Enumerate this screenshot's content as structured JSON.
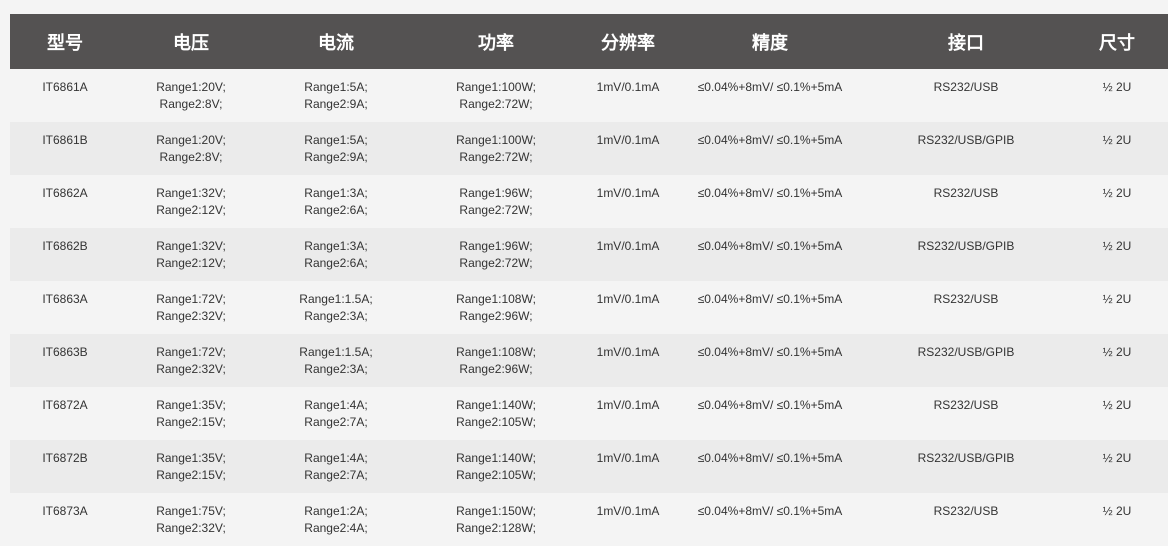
{
  "headers": [
    "型号",
    "电压",
    "电流",
    "功率",
    "分辨率",
    "精度",
    "接口",
    "尺寸"
  ],
  "rows": [
    {
      "model": "IT6861A",
      "voltage": [
        "Range1:20V;",
        "Range2:8V;"
      ],
      "current": [
        "Range1:5A;",
        "Range2:9A;"
      ],
      "power": [
        "Range1:100W;",
        "Range2:72W;"
      ],
      "resolution": "1mV/0.1mA",
      "accuracy": "≤0.04%+8mV/ ≤0.1%+5mA",
      "interface": "RS232/USB",
      "size": "½ 2U"
    },
    {
      "model": "IT6861B",
      "voltage": [
        "Range1:20V;",
        "Range2:8V;"
      ],
      "current": [
        "Range1:5A;",
        "Range2:9A;"
      ],
      "power": [
        "Range1:100W;",
        "Range2:72W;"
      ],
      "resolution": "1mV/0.1mA",
      "accuracy": "≤0.04%+8mV/ ≤0.1%+5mA",
      "interface": "RS232/USB/GPIB",
      "size": "½ 2U"
    },
    {
      "model": "IT6862A",
      "voltage": [
        "Range1:32V;",
        "Range2:12V;"
      ],
      "current": [
        "Range1:3A;",
        "Range2:6A;"
      ],
      "power": [
        "Range1:96W;",
        "Range2:72W;"
      ],
      "resolution": "1mV/0.1mA",
      "accuracy": "≤0.04%+8mV/ ≤0.1%+5mA",
      "interface": "RS232/USB",
      "size": "½ 2U"
    },
    {
      "model": "IT6862B",
      "voltage": [
        "Range1:32V;",
        "Range2:12V;"
      ],
      "current": [
        "Range1:3A;",
        "Range2:6A;"
      ],
      "power": [
        "Range1:96W;",
        "Range2:72W;"
      ],
      "resolution": "1mV/0.1mA",
      "accuracy": "≤0.04%+8mV/ ≤0.1%+5mA",
      "interface": "RS232/USB/GPIB",
      "size": "½ 2U"
    },
    {
      "model": "IT6863A",
      "voltage": [
        "Range1:72V;",
        "Range2:32V;"
      ],
      "current": [
        "Range1:1.5A;",
        "Range2:3A;"
      ],
      "power": [
        "Range1:108W;",
        "Range2:96W;"
      ],
      "resolution": "1mV/0.1mA",
      "accuracy": "≤0.04%+8mV/ ≤0.1%+5mA",
      "interface": "RS232/USB",
      "size": "½ 2U"
    },
    {
      "model": "IT6863B",
      "voltage": [
        "Range1:72V;",
        "Range2:32V;"
      ],
      "current": [
        "Range1:1.5A;",
        "Range2:3A;"
      ],
      "power": [
        "Range1:108W;",
        "Range2:96W;"
      ],
      "resolution": "1mV/0.1mA",
      "accuracy": "≤0.04%+8mV/ ≤0.1%+5mA",
      "interface": "RS232/USB/GPIB",
      "size": "½ 2U"
    },
    {
      "model": "IT6872A",
      "voltage": [
        "Range1:35V;",
        "Range2:15V;"
      ],
      "current": [
        "Range1:4A;",
        "Range2:7A;"
      ],
      "power": [
        "Range1:140W;",
        "Range2:105W;"
      ],
      "resolution": "1mV/0.1mA",
      "accuracy": "≤0.04%+8mV/ ≤0.1%+5mA",
      "interface": "RS232/USB",
      "size": "½ 2U"
    },
    {
      "model": "IT6872B",
      "voltage": [
        "Range1:35V;",
        "Range2:15V;"
      ],
      "current": [
        "Range1:4A;",
        "Range2:7A;"
      ],
      "power": [
        "Range1:140W;",
        "Range2:105W;"
      ],
      "resolution": "1mV/0.1mA",
      "accuracy": "≤0.04%+8mV/ ≤0.1%+5mA",
      "interface": "RS232/USB/GPIB",
      "size": "½ 2U"
    },
    {
      "model": "IT6873A",
      "voltage": [
        "Range1:75V;",
        "Range2:32V;"
      ],
      "current": [
        "Range1:2A;",
        "Range2:4A;"
      ],
      "power": [
        "Range1:150W;",
        "Range2:128W;"
      ],
      "resolution": "1mV/0.1mA",
      "accuracy": "≤0.04%+8mV/ ≤0.1%+5mA",
      "interface": "RS232/USB",
      "size": "½ 2U"
    }
  ]
}
